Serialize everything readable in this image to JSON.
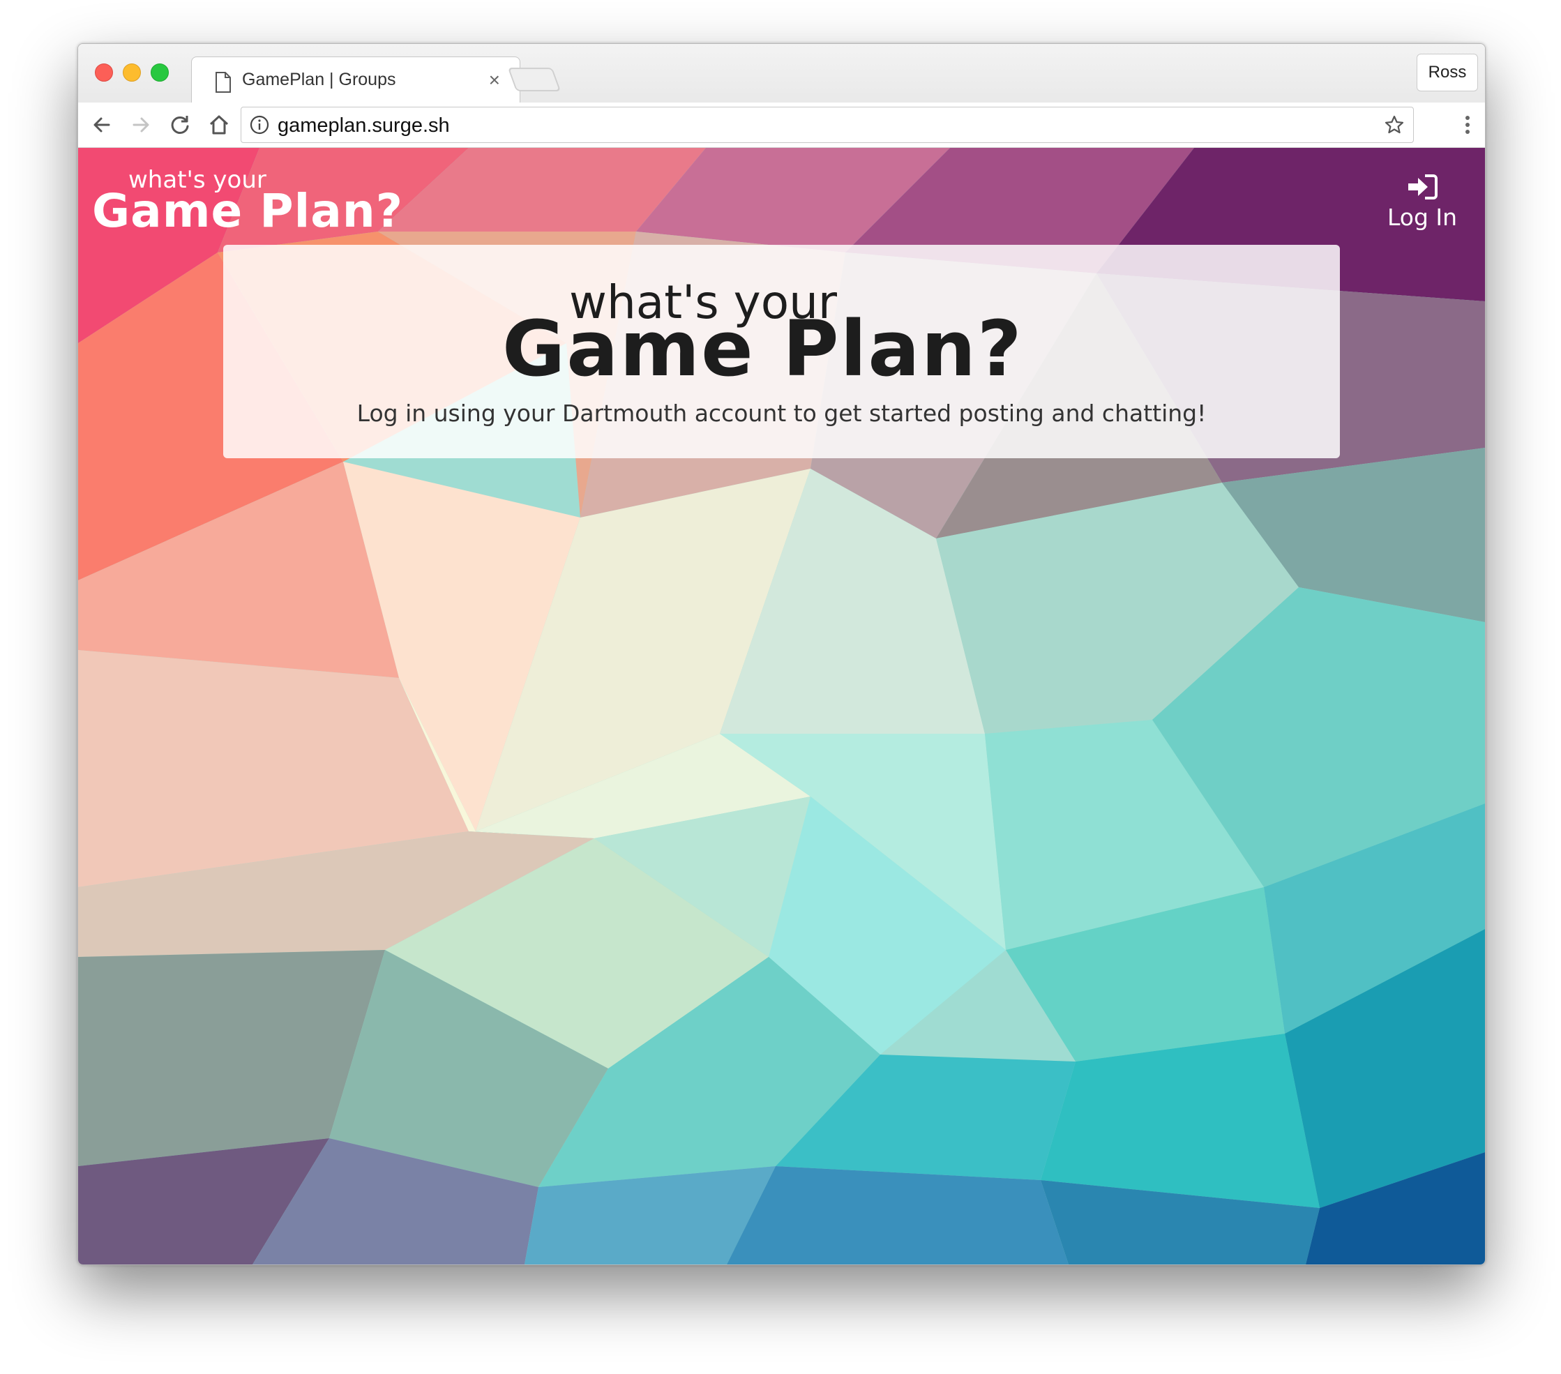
{
  "browser": {
    "tab_title": "GamePlan | Groups",
    "tab_close_symbol": "×",
    "profile_name": "Ross",
    "url": "gameplan.surge.sh",
    "icons": [
      "back-icon",
      "forward-icon",
      "reload-icon",
      "home-icon",
      "info-icon",
      "star-icon",
      "menu-icon",
      "page-icon"
    ]
  },
  "site": {
    "logo_small": "what's your",
    "logo_big": "Game Plan?",
    "login_label": "Log In",
    "login_icon": "sign-in-icon"
  },
  "hero": {
    "small": "what's your",
    "big": "Game Plan?",
    "subtitle": "Log in using your Dartmouth account to get started posting and chatting!"
  },
  "colors": {
    "traffic_red": "#fc5f57",
    "traffic_yellow": "#fdbc2e",
    "traffic_green": "#28c840",
    "bg_top_left": "#f24a72",
    "bg_top_right": "#6e2468",
    "bg_center": "#9ce8df",
    "bg_bottom_right": "#0f5a98"
  }
}
